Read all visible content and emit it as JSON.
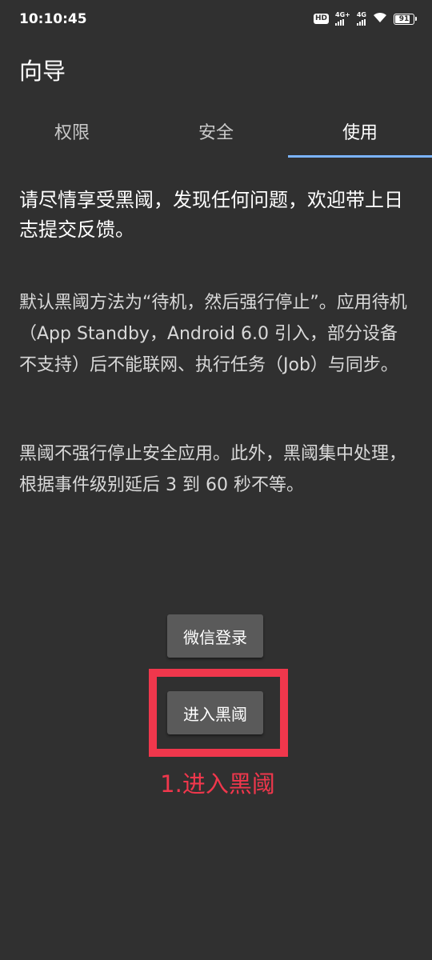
{
  "status_bar": {
    "time": "10:10:45",
    "hd_label": "HD",
    "signal1_label": "4G+",
    "signal2_label": "4G",
    "battery_level": "91",
    "battery_fraction": 0.91
  },
  "toolbar": {
    "title": "向导"
  },
  "tabs": [
    {
      "label": "权限",
      "active": false
    },
    {
      "label": "安全",
      "active": false
    },
    {
      "label": "使用",
      "active": true
    }
  ],
  "content": {
    "intro": "请尽情享受黑阈，发现任何问题，欢迎带上日志提交反馈。",
    "paragraph1": "默认黑阈方法为“待机，然后强行停止”。应用待机（App Standby，Android 6.0 引入，部分设备不支持）后不能联网、执行任务（Job）与同步。",
    "paragraph2": "黑阈不强行停止安全应用。此外，黑阈集中处理，根据事件级别延后 3 到 60 秒不等。"
  },
  "buttons": {
    "wechat_login": "微信登录",
    "enter": "进入黑阈"
  },
  "annotation": {
    "text": "1.进入黑阈",
    "color": "#f0374c"
  },
  "colors": {
    "background": "#303030",
    "accent": "#7bb4ff",
    "button": "#5a5a5a"
  }
}
